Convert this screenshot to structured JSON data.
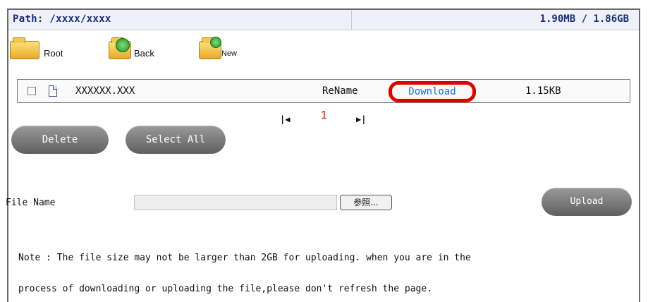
{
  "header": {
    "path_text": "Path: /xxxx/xxxx",
    "usage_text": "1.90MB / 1.86GB"
  },
  "nav": {
    "root_label": "Root",
    "back_label": "Back",
    "new_label": "New"
  },
  "file_row": {
    "name": "XXXXXX.XXX",
    "rename_label": "ReName",
    "download_label": "Download",
    "size": "1.15KB"
  },
  "pager": {
    "first_glyph": "|◀",
    "page": "1",
    "last_glyph": "▶|"
  },
  "actions": {
    "delete_label": "Delete",
    "select_all_label": "Select All"
  },
  "upload": {
    "file_name_label": "File Name",
    "browse_label": "参照...",
    "upload_label": "Upload"
  },
  "note": {
    "line1": "Note : The file size may not be larger than 2GB for uploading. when you are in the",
    "line2": "process of downloading or uploading the file,please don't refresh the page."
  },
  "colors": {
    "highlight_ring": "#e00000",
    "link": "#1a6fe0",
    "header_text": "#1a2d7a"
  }
}
